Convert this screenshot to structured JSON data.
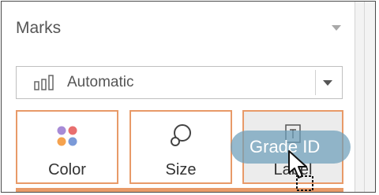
{
  "marks_panel": {
    "title": "Marks",
    "mark_type": {
      "selected": "Automatic",
      "icon": "bar-chart-icon"
    },
    "cards": [
      {
        "label": "Color",
        "icon": "color-dots-icon",
        "dot_colors": [
          "#a78bd6",
          "#e86f6f",
          "#f5a24e",
          "#7b9ad8"
        ]
      },
      {
        "label": "Size",
        "icon": "size-circles-icon"
      },
      {
        "label": "Label",
        "icon": "text-label-icon"
      }
    ],
    "accent_color": "#e89a68"
  },
  "drag": {
    "field": "Grade ID",
    "pill_color": "#6c9eba"
  }
}
